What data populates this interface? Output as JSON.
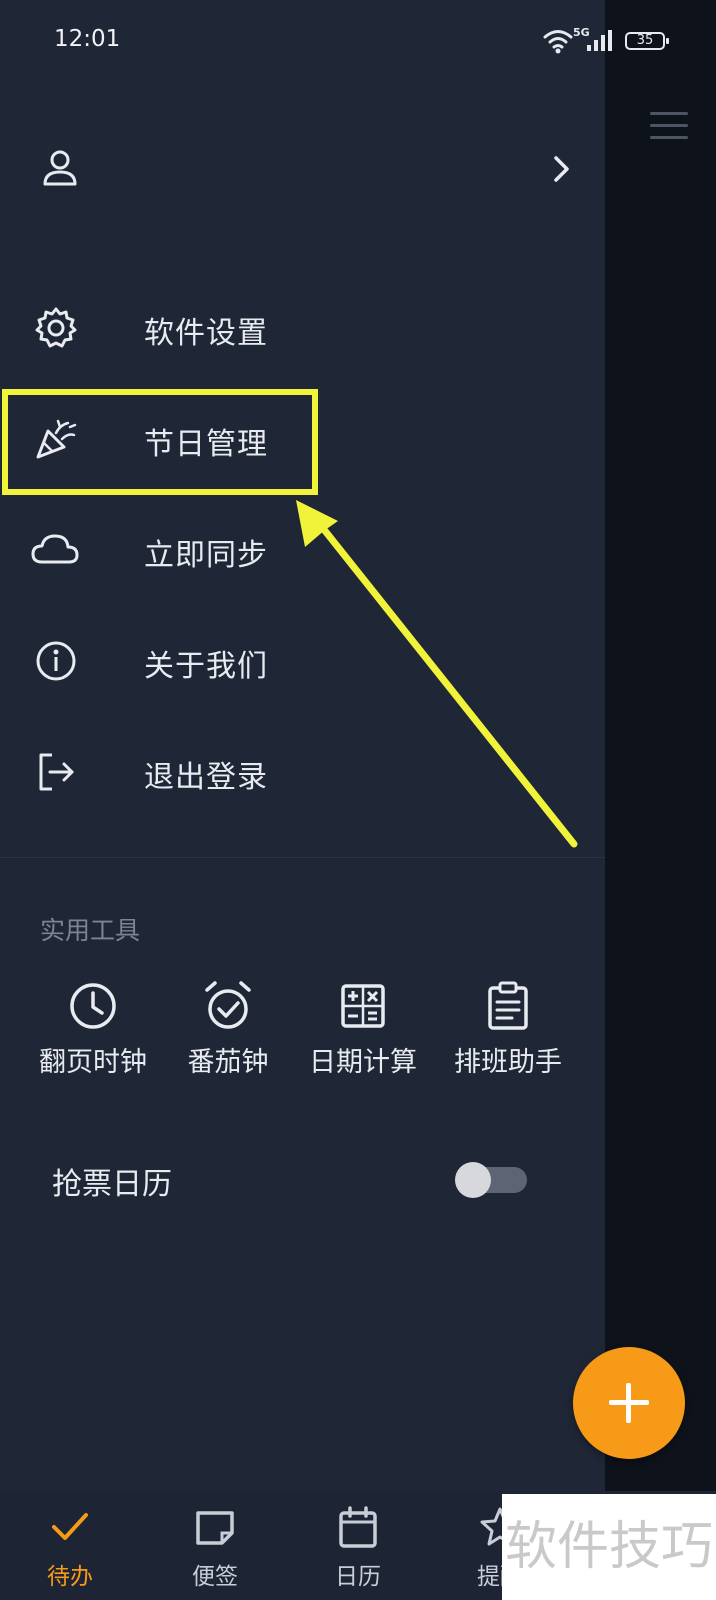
{
  "status_bar": {
    "time": "12:01",
    "network": "5G",
    "battery": "35"
  },
  "menu": [
    {
      "label": "软件设置",
      "icon": "gear-icon"
    },
    {
      "label": "节日管理",
      "icon": "party-popper-icon"
    },
    {
      "label": "立即同步",
      "icon": "cloud-icon"
    },
    {
      "label": "关于我们",
      "icon": "info-icon"
    },
    {
      "label": "退出登录",
      "icon": "logout-icon"
    }
  ],
  "tools": {
    "title": "实用工具",
    "items": [
      {
        "label": "翻页时钟",
        "icon": "clock-icon"
      },
      {
        "label": "番茄钟",
        "icon": "alarm-check-icon"
      },
      {
        "label": "日期计算",
        "icon": "calculator-icon"
      },
      {
        "label": "排班助手",
        "icon": "clipboard-icon"
      }
    ]
  },
  "ticket_calendar": {
    "label": "抢票日历",
    "enabled": false
  },
  "bottom_nav": [
    {
      "label": "待办",
      "icon": "check-icon",
      "active": true
    },
    {
      "label": "便签",
      "icon": "note-icon",
      "active": false
    },
    {
      "label": "日历",
      "icon": "calendar-icon",
      "active": false
    },
    {
      "label": "提醒",
      "icon": "star-icon",
      "active": false
    }
  ],
  "watermark": "软件技巧",
  "colors": {
    "accent": "#f79a18",
    "highlight": "#f1f23a",
    "drawer_bg": "#1f2636"
  }
}
